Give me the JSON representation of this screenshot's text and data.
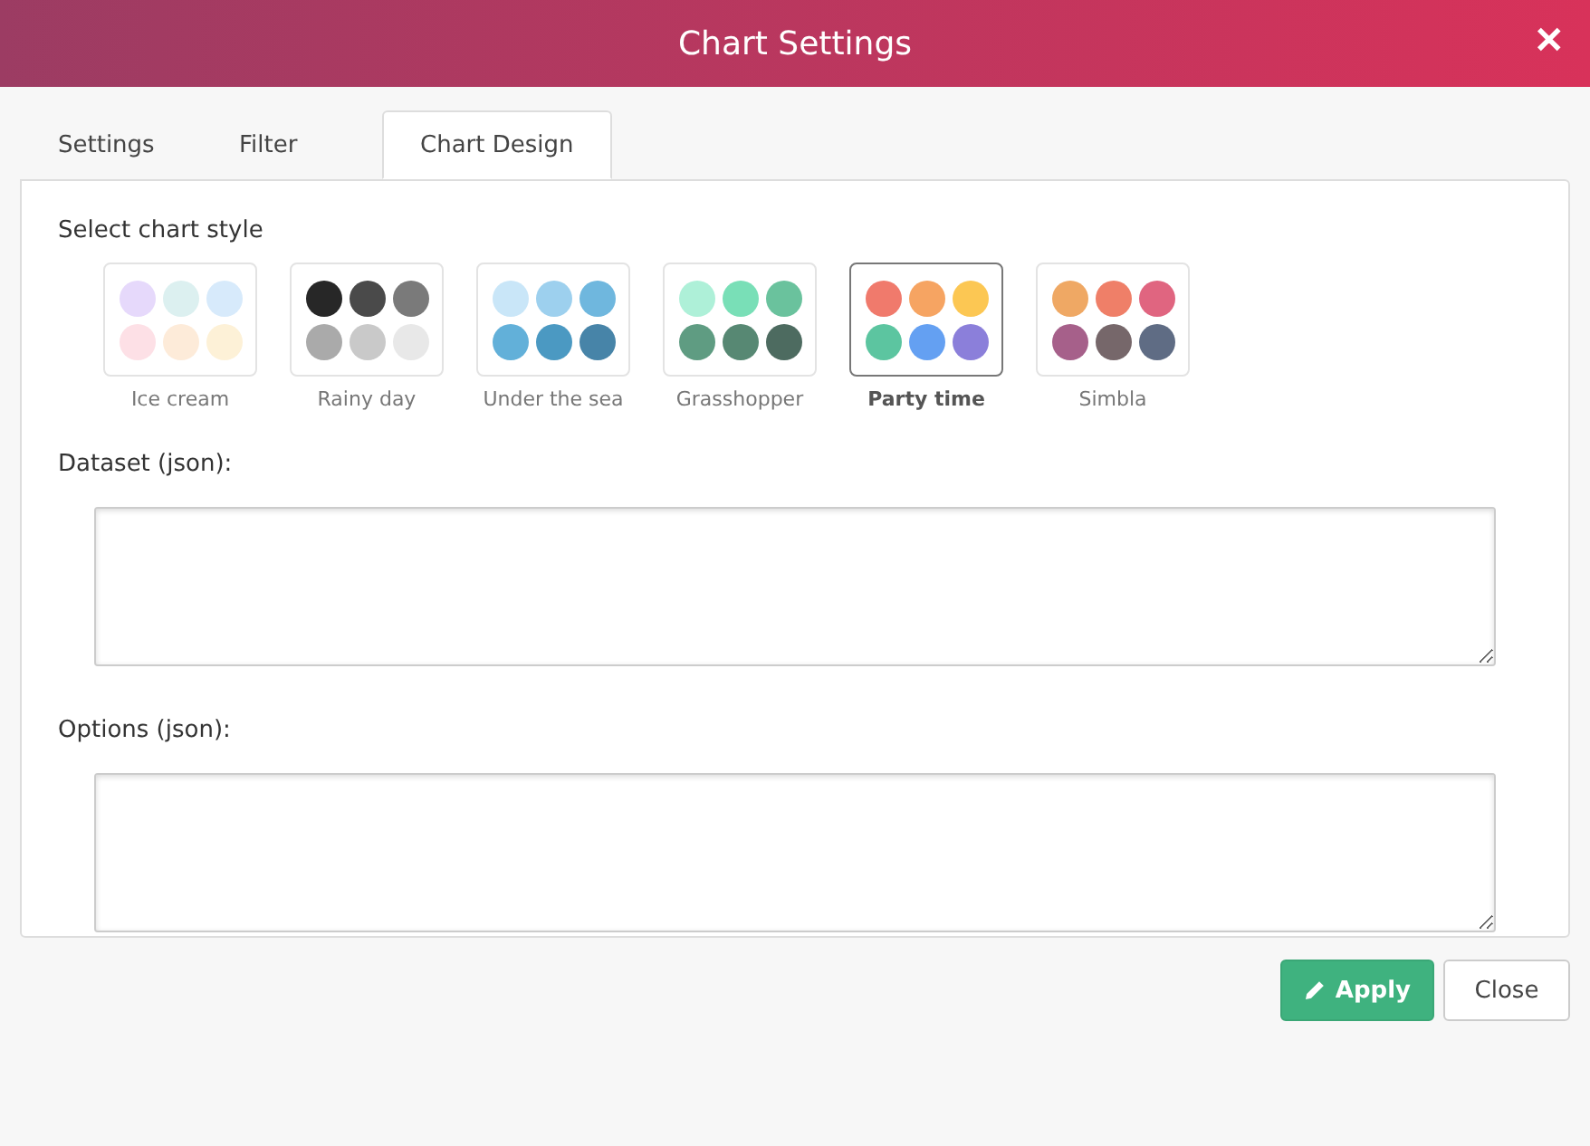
{
  "window": {
    "title": "Chart Settings",
    "close": "✕"
  },
  "tabs": [
    {
      "label": "Settings",
      "selected": false
    },
    {
      "label": "Filter",
      "selected": false
    },
    {
      "label": "Chart Design",
      "selected": true
    }
  ],
  "style_label": "Select chart style",
  "styles": [
    {
      "name": "Ice cream",
      "selected": false,
      "dots": [
        {
          "color": "#e6d9fb"
        },
        {
          "color": "#dcf0f0"
        },
        {
          "color": "#d7eafb"
        },
        {
          "color": "#fde0e6"
        },
        {
          "color": "#fdebd9"
        },
        {
          "color": "#fdf1d7"
        }
      ]
    },
    {
      "name": "Rainy day",
      "selected": false,
      "dots": [
        {
          "color": "#272727"
        },
        {
          "color": "#4a4a4a"
        },
        {
          "color": "#7a7a7a"
        },
        {
          "color": "#aaaaaa"
        },
        {
          "color": "#c9c9c9"
        },
        {
          "color": "#e8e8e8"
        }
      ]
    },
    {
      "name": "Under the sea",
      "selected": false,
      "dots": [
        {
          "color": "#c9e6f8"
        },
        {
          "color": "#9dd0ee"
        },
        {
          "color": "#6fb7de"
        },
        {
          "color": "#62b0d9"
        },
        {
          "color": "#4b99c2"
        },
        {
          "color": "#4784a8"
        }
      ]
    },
    {
      "name": "Grasshopper",
      "selected": false,
      "dots": [
        {
          "color": "#aef0d8"
        },
        {
          "color": "#79dfb7"
        },
        {
          "color": "#6ac29d"
        },
        {
          "color": "#5f9c82"
        },
        {
          "color": "#578873"
        },
        {
          "color": "#4d6b60"
        }
      ]
    },
    {
      "name": "Party time",
      "selected": true,
      "dots": [
        {
          "color": "#f07a6c"
        },
        {
          "color": "#f6a462"
        },
        {
          "color": "#fcc753"
        },
        {
          "color": "#5cc5a0"
        },
        {
          "color": "#64a0f2"
        },
        {
          "color": "#8b7fda"
        }
      ]
    },
    {
      "name": "Simbla",
      "selected": false,
      "dots": [
        {
          "color": "#efa864"
        },
        {
          "color": "#ef7f68"
        },
        {
          "color": "#e06580"
        },
        {
          "color": "#a6608a"
        },
        {
          "color": "#76676a"
        },
        {
          "color": "#5f6c84"
        }
      ]
    }
  ],
  "fields": [
    {
      "label": "Dataset (json):"
    },
    {
      "label": "Options (json):"
    }
  ],
  "buttons": [
    {
      "kind": "primary",
      "label": "Apply"
    },
    {
      "kind": "secondary",
      "label": "Close"
    }
  ]
}
